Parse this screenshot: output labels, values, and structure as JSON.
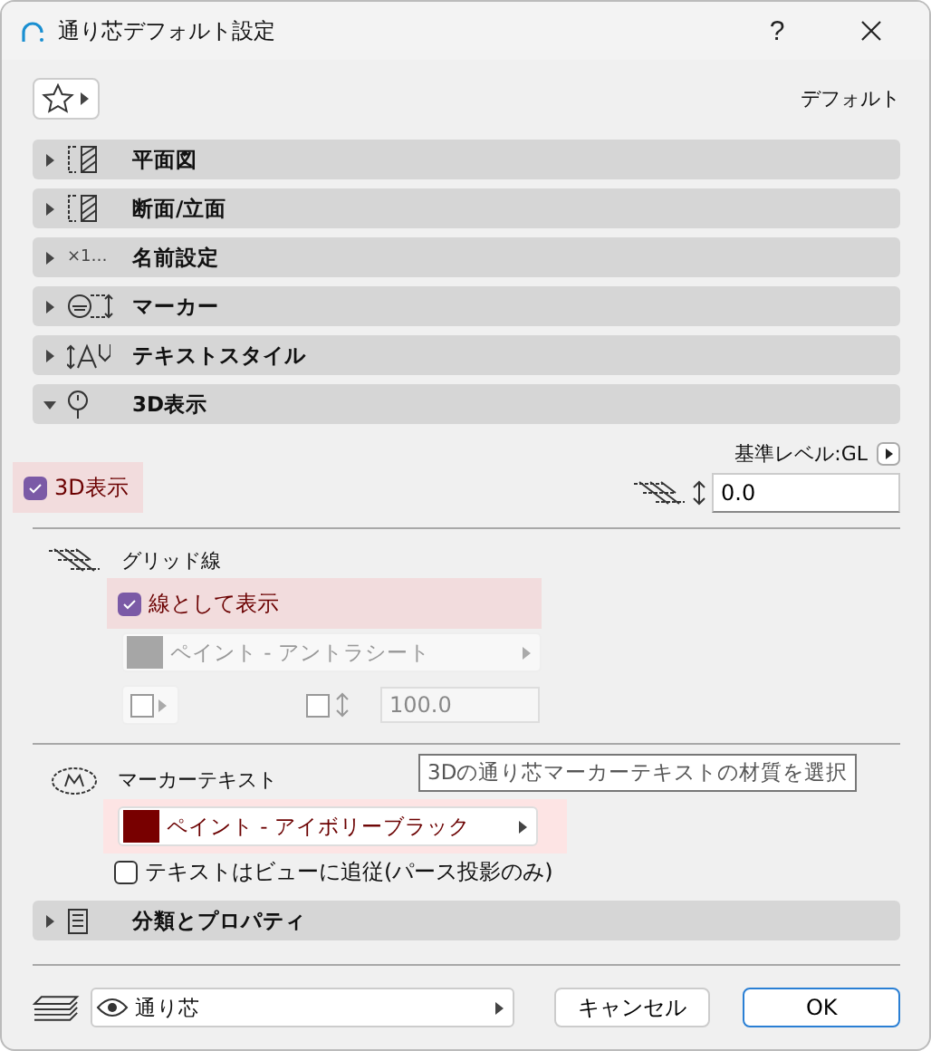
{
  "window": {
    "title": "通り芯デフォルト設定",
    "help": "?"
  },
  "favorites": {
    "label": "デフォルト"
  },
  "sections": [
    {
      "label": "平面図",
      "kind": "plan",
      "expanded": false
    },
    {
      "label": "断面/立面",
      "kind": "plan",
      "expanded": false
    },
    {
      "label": "名前設定",
      "kind": "naming",
      "icon_text": "×1…",
      "expanded": false
    },
    {
      "label": "マーカー",
      "kind": "marker",
      "expanded": false
    },
    {
      "label": "テキストスタイル",
      "kind": "text",
      "expanded": false
    },
    {
      "label": "3D表示",
      "kind": "pin",
      "expanded": true
    },
    {
      "label": "分類とプロパティ",
      "kind": "doc",
      "expanded": false
    }
  ],
  "view3d": {
    "reference_level": "基準レベル:GL",
    "elevation": "0.0",
    "show_3d": {
      "label": "3D表示",
      "checked": true,
      "highlighted": true
    },
    "grid_line": {
      "title": "グリッド線",
      "show_as_line": {
        "label": "線として表示",
        "checked": true,
        "highlighted": true
      },
      "paint": {
        "label": "ペイント - アントラシート",
        "color": "#a6a6a6",
        "disabled": true
      },
      "thickness": "100.0"
    },
    "marker_text": {
      "title": "マーカーテキスト",
      "paint": {
        "label": "ペイント - アイボリーブラック",
        "color": "#780000",
        "highlighted": true
      },
      "tooltip": "3Dの通り芯マーカーテキストの材質を選択",
      "follow_view": {
        "label": "テキストはビューに追従(パース投影のみ)",
        "checked": false
      }
    }
  },
  "footer": {
    "layer": "通り芯",
    "cancel": "キャンセル",
    "ok": "OK"
  }
}
